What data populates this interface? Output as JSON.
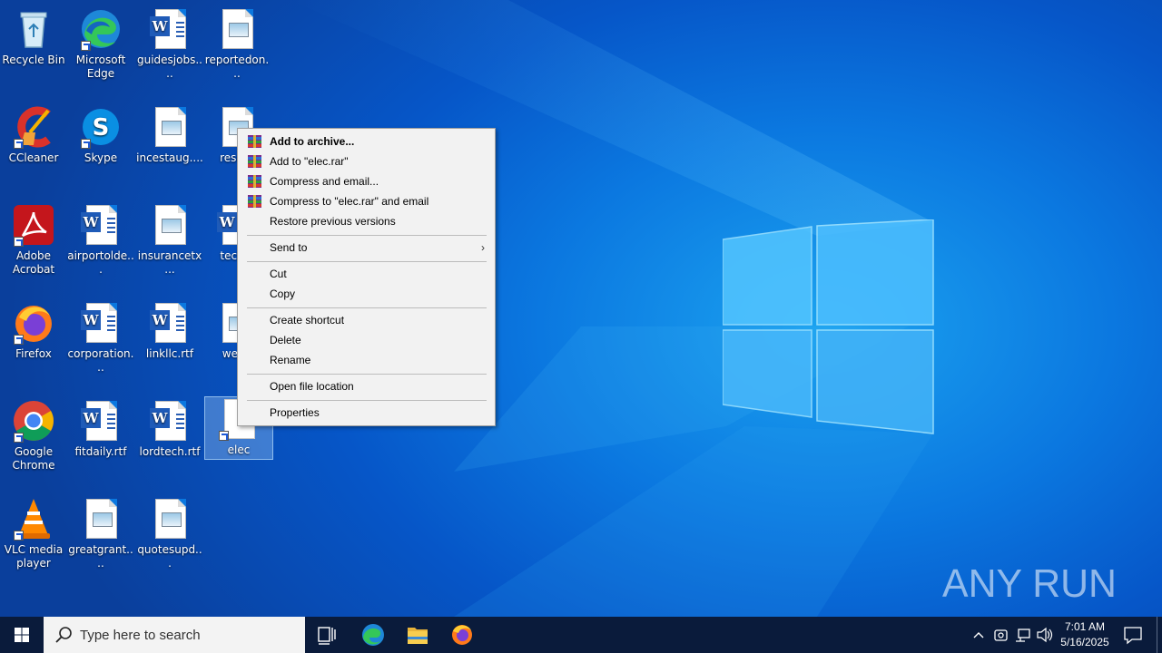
{
  "desktop": {
    "icons": [
      {
        "label": "Recycle Bin"
      },
      {
        "label": "Microsoft Edge"
      },
      {
        "label": "guidesjobs...."
      },
      {
        "label": "reportedon..."
      },
      {
        "label": "CCleaner"
      },
      {
        "label": "Skype"
      },
      {
        "label": "incestaug...."
      },
      {
        "label": "reserv"
      },
      {
        "label": "Adobe Acrobat"
      },
      {
        "label": "airportolde..."
      },
      {
        "label": "insurancetx..."
      },
      {
        "label": "techni"
      },
      {
        "label": "Firefox"
      },
      {
        "label": "corporation..."
      },
      {
        "label": "linkllc.rtf"
      },
      {
        "label": "wedn"
      },
      {
        "label": "Google Chrome"
      },
      {
        "label": "fitdaily.rtf"
      },
      {
        "label": "lordtech.rtf"
      },
      {
        "label": "elec"
      },
      {
        "label": "VLC media player"
      },
      {
        "label": "greatgrant...."
      },
      {
        "label": "quotesupd..."
      }
    ]
  },
  "context_menu": {
    "items": [
      {
        "label": "Add to archive...",
        "icon": "winrar-icon"
      },
      {
        "label": "Add to \"elec.rar\"",
        "icon": "winrar-icon"
      },
      {
        "label": "Compress and email...",
        "icon": "winrar-icon"
      },
      {
        "label": "Compress to \"elec.rar\" and email",
        "icon": "winrar-icon"
      },
      {
        "label": "Restore previous versions"
      },
      {
        "label": "Send to",
        "submenu_arrow": "›"
      },
      {
        "label": "Cut"
      },
      {
        "label": "Copy"
      },
      {
        "label": "Create shortcut"
      },
      {
        "label": "Delete"
      },
      {
        "label": "Rename"
      },
      {
        "label": "Open file location"
      },
      {
        "label": "Properties"
      }
    ]
  },
  "taskbar": {
    "search_placeholder": "Type here to search",
    "time": "7:01 AM",
    "date": "5/16/2025",
    "pinned": [
      "task-view-icon",
      "edge-icon",
      "file-explorer-icon",
      "firefox-icon"
    ],
    "tray": [
      "chevron-up-icon",
      "meet-now-icon",
      "network-icon",
      "volume-icon",
      "notification-icon"
    ]
  },
  "watermark": {
    "text": "ANY RUN"
  }
}
